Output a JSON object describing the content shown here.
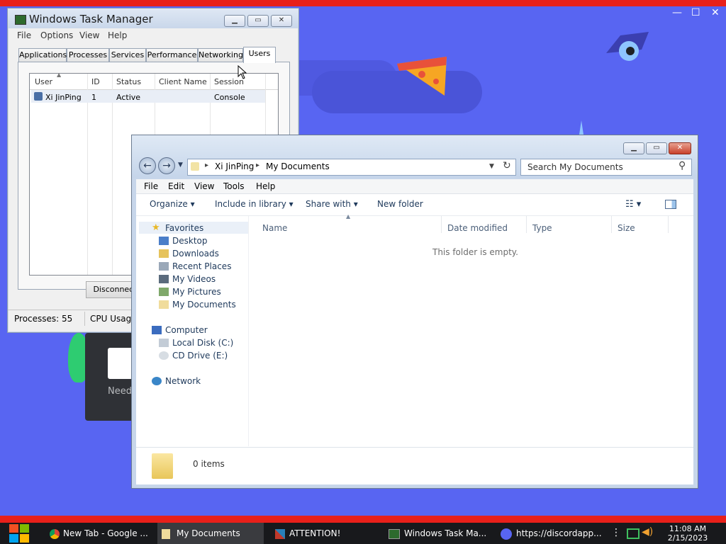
{
  "colors": {
    "discord_bg": "#5865f2",
    "accent_red": "#e8201a",
    "taskbar": "#18191c"
  },
  "background": {
    "window_controls": [
      "—",
      "☐",
      "✕"
    ],
    "dialog_text": "Need"
  },
  "task_manager": {
    "title": "Windows Task Manager",
    "menu": [
      "File",
      "Options",
      "View",
      "Help"
    ],
    "tabs": [
      "Applications",
      "Processes",
      "Services",
      "Performance",
      "Networking",
      "Users"
    ],
    "active_tab": "Users",
    "columns": [
      "User",
      "ID",
      "Status",
      "Client Name",
      "Session"
    ],
    "rows": [
      {
        "user": "Xi JinPing",
        "id": "1",
        "status": "Active",
        "client_name": "",
        "session": "Console"
      }
    ],
    "disconnect_label": "Disconnect",
    "status_processes": "Processes: 55",
    "status_cpu": "CPU Usage"
  },
  "explorer": {
    "breadcrumb": [
      "Xi JinPing",
      "My Documents"
    ],
    "search_placeholder": "Search My Documents",
    "menu": [
      "File",
      "Edit",
      "View",
      "Tools",
      "Help"
    ],
    "toolbar": {
      "organize": "Organize",
      "include": "Include in library",
      "share": "Share with",
      "new_folder": "New folder"
    },
    "nav": {
      "favorites": "Favorites",
      "favorites_items": [
        "Desktop",
        "Downloads",
        "Recent Places",
        "My Videos",
        "My Pictures",
        "My Documents"
      ],
      "computer": "Computer",
      "computer_items": [
        "Local Disk (C:)",
        "CD Drive (E:)"
      ],
      "network": "Network"
    },
    "columns": [
      "Name",
      "Date modified",
      "Type",
      "Size"
    ],
    "empty_message": "This folder is empty.",
    "item_count": "0 items"
  },
  "taskbar": {
    "items": [
      "New Tab - Google ...",
      "My Documents",
      "ATTENTION!",
      "Windows Task Ma...",
      "https://discordapp...."
    ],
    "time": "11:08 AM",
    "date": "2/15/2023"
  }
}
